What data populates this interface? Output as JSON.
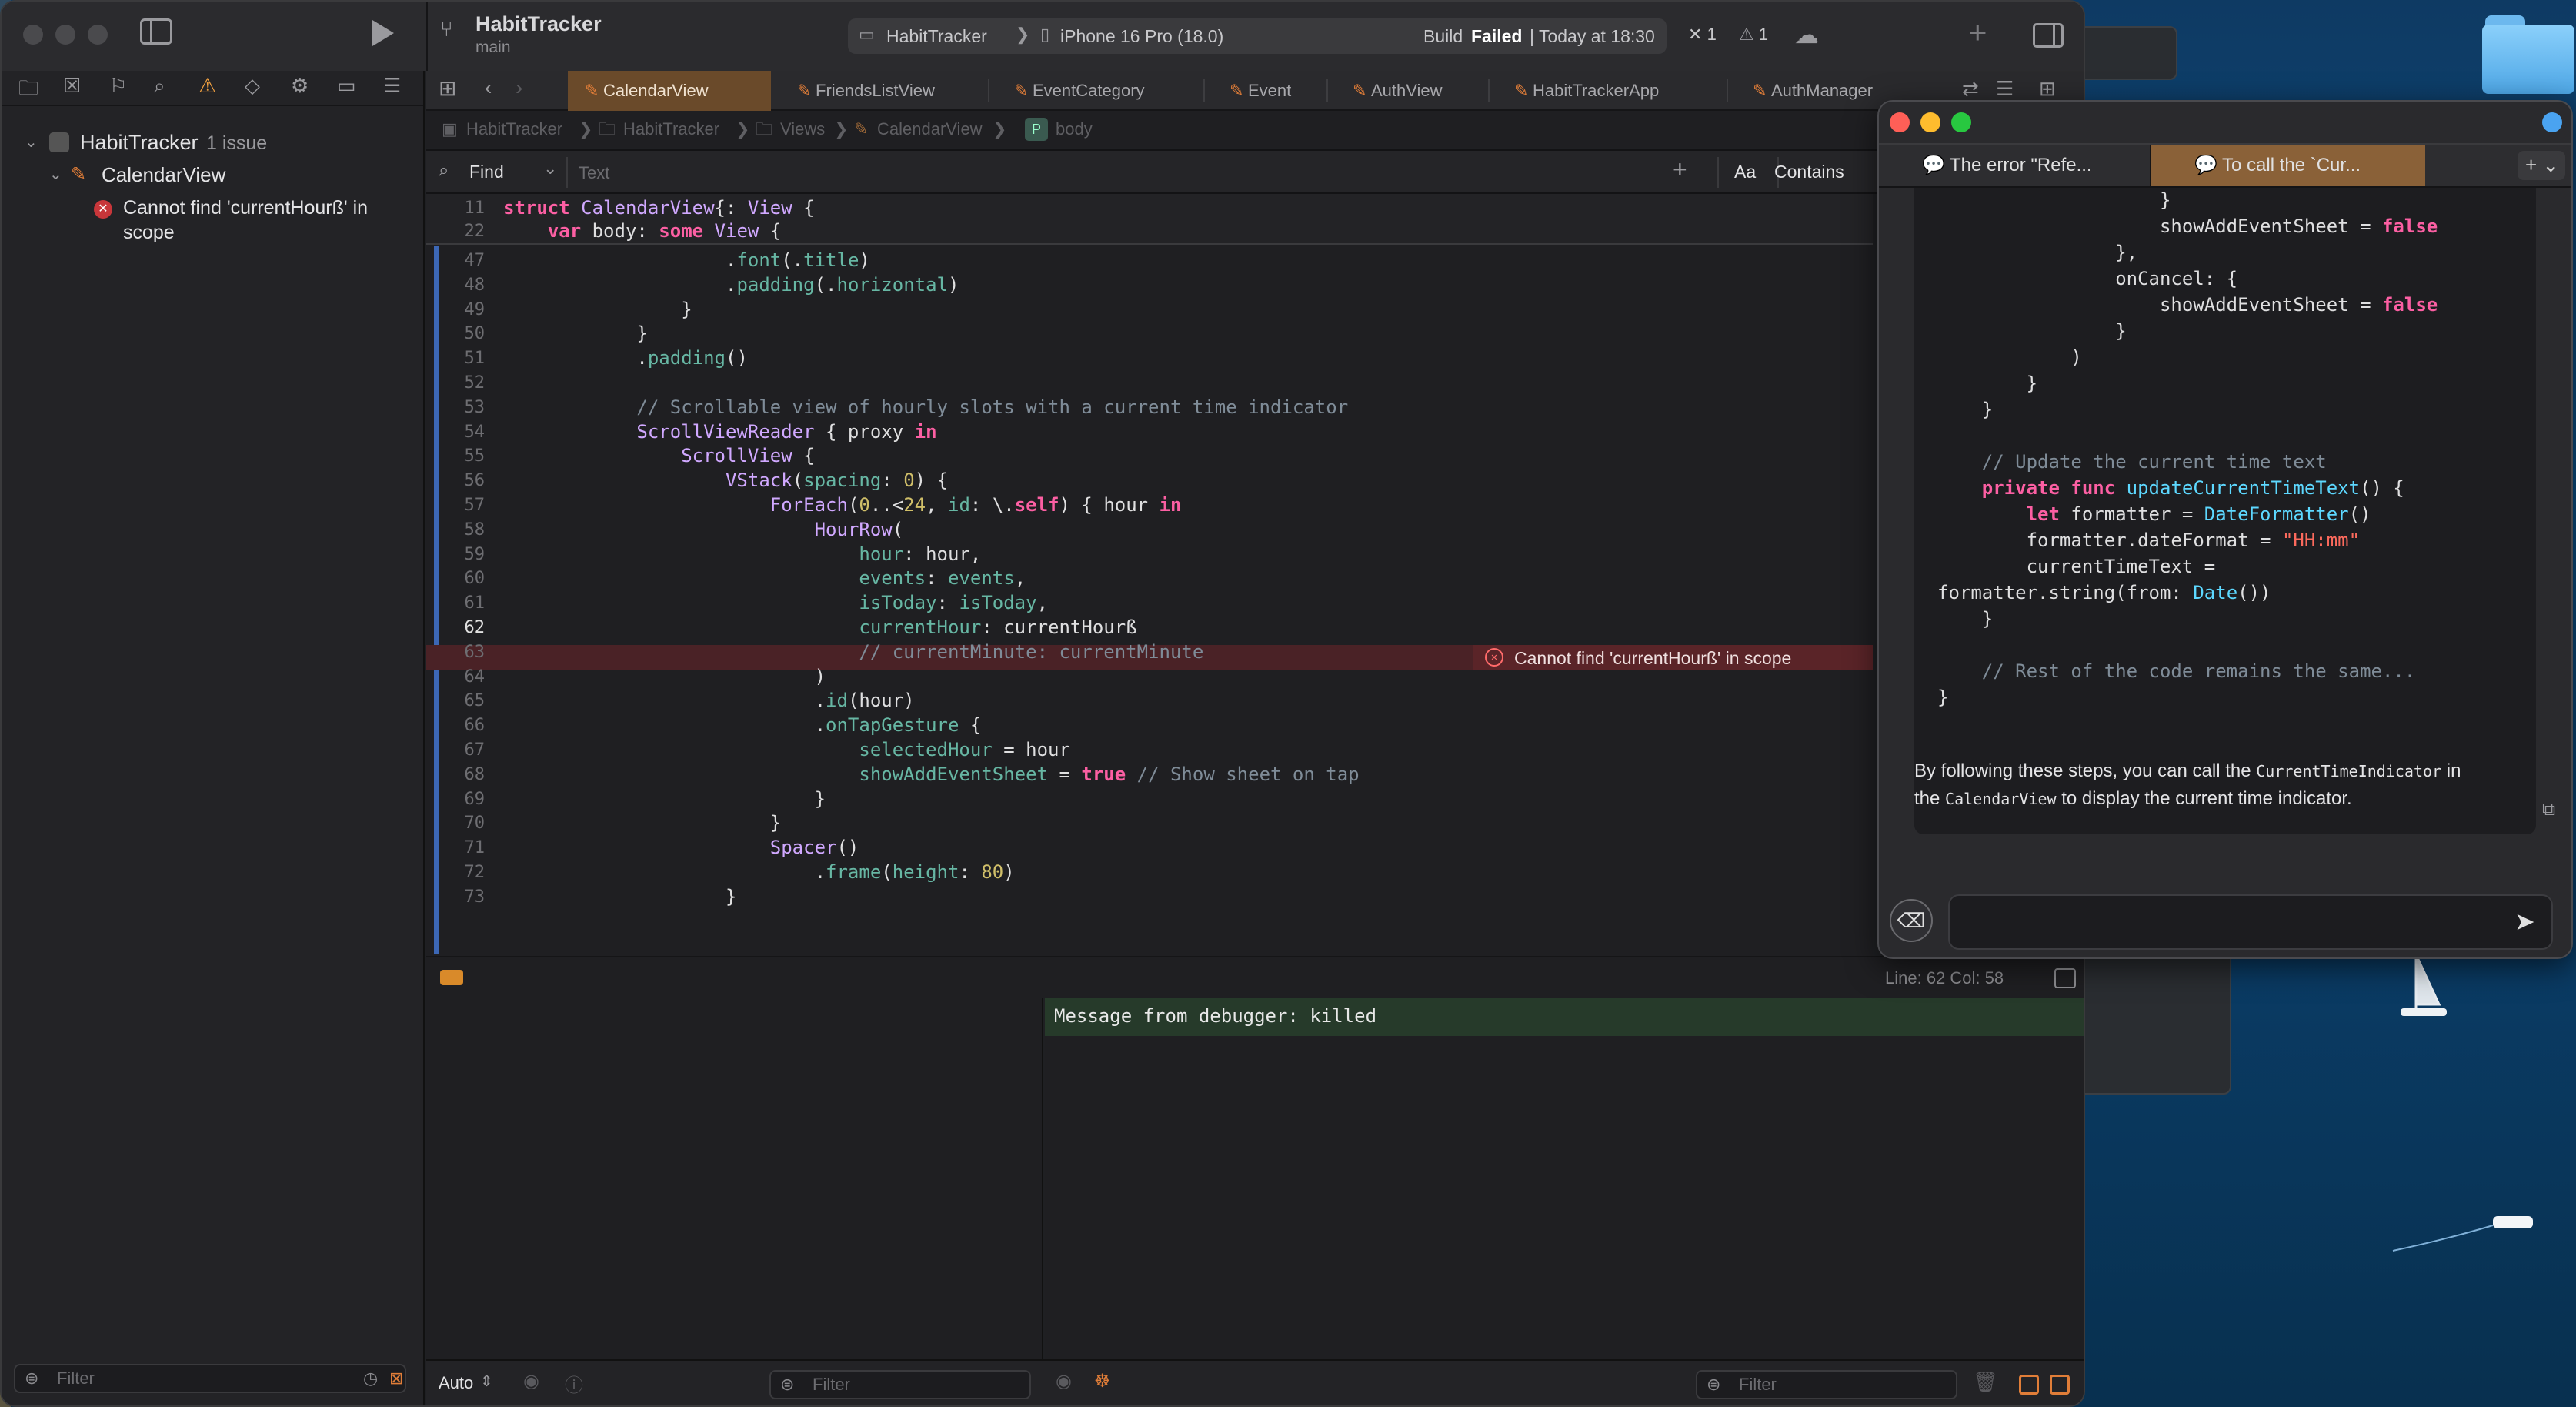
{
  "window": {
    "project_name": "HabitTracker",
    "branch": "main",
    "scheme": "HabitTracker",
    "destination": "iPhone 16 Pro (18.0)",
    "build_status_prefix": "Build",
    "build_status_result": "Failed",
    "build_status_time": "| Today at 18:30",
    "error_count": "1",
    "warning_count": "1"
  },
  "issue_navigator": {
    "project": "HabitTracker",
    "project_issue_count": "1 issue",
    "file": "CalendarView",
    "issue_line1": "Cannot find 'currentHourß' in",
    "issue_line2": "scope",
    "filter_placeholder": "Filter"
  },
  "tabs": [
    {
      "label": "CalendarView"
    },
    {
      "label": "FriendsListView"
    },
    {
      "label": "EventCategory"
    },
    {
      "label": "Event"
    },
    {
      "label": "AuthView"
    },
    {
      "label": "HabitTrackerApp"
    },
    {
      "label": "AuthManager"
    }
  ],
  "breadcrumb": [
    "HabitTracker",
    "HabitTracker",
    "Views",
    "CalendarView",
    "body"
  ],
  "find": {
    "mode": "Find",
    "placeholder": "Text",
    "case_label": "Aa",
    "match_mode": "Contains"
  },
  "sticky_header": [
    {
      "num": "11",
      "tokens": [
        [
          "kw",
          "struct "
        ],
        [
          "ty",
          "CalendarView"
        ],
        [
          "",
          "{: "
        ],
        [
          "ty",
          "View"
        ],
        [
          "",
          " {"
        ]
      ]
    },
    {
      "num": "22",
      "tokens": [
        [
          "",
          "    "
        ],
        [
          "kw",
          "var "
        ],
        [
          "",
          "body: "
        ],
        [
          "kw",
          "some "
        ],
        [
          "ty",
          "View"
        ],
        [
          "",
          " {"
        ]
      ]
    }
  ],
  "code_lines": [
    {
      "num": "47",
      "tokens": [
        [
          "",
          "                    ."
        ],
        [
          "fn",
          "font"
        ],
        [
          "",
          "(."
        ],
        [
          "fn",
          "title"
        ],
        [
          "",
          ")"
        ]
      ]
    },
    {
      "num": "48",
      "tokens": [
        [
          "",
          "                    ."
        ],
        [
          "fn",
          "padding"
        ],
        [
          "",
          "(."
        ],
        [
          "fn",
          "horizontal"
        ],
        [
          "",
          ")"
        ]
      ]
    },
    {
      "num": "49",
      "tokens": [
        [
          "",
          "                }"
        ]
      ]
    },
    {
      "num": "50",
      "tokens": [
        [
          "",
          "            }"
        ]
      ]
    },
    {
      "num": "51",
      "tokens": [
        [
          "",
          "            ."
        ],
        [
          "fn",
          "padding"
        ],
        [
          "",
          "()"
        ]
      ]
    },
    {
      "num": "52",
      "tokens": [
        [
          "",
          ""
        ]
      ]
    },
    {
      "num": "53",
      "tokens": [
        [
          "cm",
          "            // Scrollable view of hourly slots with a current time indicator"
        ]
      ]
    },
    {
      "num": "54",
      "tokens": [
        [
          "",
          "            "
        ],
        [
          "ty",
          "ScrollViewReader"
        ],
        [
          "",
          " { proxy "
        ],
        [
          "kw",
          "in"
        ]
      ]
    },
    {
      "num": "55",
      "tokens": [
        [
          "",
          "                "
        ],
        [
          "ty",
          "ScrollView"
        ],
        [
          "",
          " {"
        ]
      ]
    },
    {
      "num": "56",
      "tokens": [
        [
          "",
          "                    "
        ],
        [
          "ty",
          "VStack"
        ],
        [
          "",
          "("
        ],
        [
          "fn",
          "spacing"
        ],
        [
          "",
          ": "
        ],
        [
          "nm",
          "0"
        ],
        [
          "",
          ") {"
        ]
      ]
    },
    {
      "num": "57",
      "tokens": [
        [
          "",
          "                        "
        ],
        [
          "ty",
          "ForEach"
        ],
        [
          "",
          "("
        ],
        [
          "nm",
          "0"
        ],
        [
          "",
          "..<"
        ],
        [
          "nm",
          "24"
        ],
        [
          "",
          ", "
        ],
        [
          "fn",
          "id"
        ],
        [
          "",
          ": \\."
        ],
        [
          "kw",
          "self"
        ],
        [
          "",
          ") { hour "
        ],
        [
          "kw",
          "in"
        ]
      ]
    },
    {
      "num": "58",
      "tokens": [
        [
          "",
          "                            "
        ],
        [
          "ty",
          "HourRow"
        ],
        [
          "",
          "("
        ]
      ]
    },
    {
      "num": "59",
      "tokens": [
        [
          "",
          "                                "
        ],
        [
          "fn",
          "hour"
        ],
        [
          "",
          ": hour,"
        ]
      ]
    },
    {
      "num": "60",
      "tokens": [
        [
          "",
          "                                "
        ],
        [
          "fn",
          "events"
        ],
        [
          "",
          ": "
        ],
        [
          "fn",
          "events"
        ],
        [
          "",
          ","
        ]
      ]
    },
    {
      "num": "61",
      "tokens": [
        [
          "",
          "                                "
        ],
        [
          "fn",
          "isToday"
        ],
        [
          "",
          ": "
        ],
        [
          "fn",
          "isToday"
        ],
        [
          "",
          ","
        ]
      ]
    },
    {
      "num": "62",
      "tokens": [
        [
          "",
          "                                "
        ],
        [
          "fn",
          "currentHour"
        ],
        [
          "",
          ": currentHourß"
        ]
      ]
    },
    {
      "num": "63",
      "tokens": [
        [
          "cm",
          "                                // currentMinute: currentMinute"
        ]
      ]
    },
    {
      "num": "64",
      "tokens": [
        [
          "",
          "                            )"
        ]
      ]
    },
    {
      "num": "65",
      "tokens": [
        [
          "",
          "                            ."
        ],
        [
          "fn",
          "id"
        ],
        [
          "",
          "(hour)"
        ]
      ]
    },
    {
      "num": "66",
      "tokens": [
        [
          "",
          "                            ."
        ],
        [
          "fn",
          "onTapGesture"
        ],
        [
          "",
          " {"
        ]
      ]
    },
    {
      "num": "67",
      "tokens": [
        [
          "",
          "                                "
        ],
        [
          "fn",
          "selectedHour"
        ],
        [
          "",
          " = hour"
        ]
      ]
    },
    {
      "num": "68",
      "tokens": [
        [
          "",
          "                                "
        ],
        [
          "fn",
          "showAddEventSheet"
        ],
        [
          "",
          " = "
        ],
        [
          "kw",
          "true"
        ],
        [
          "cm",
          " // Show sheet on tap"
        ]
      ]
    },
    {
      "num": "69",
      "tokens": [
        [
          "",
          "                            }"
        ]
      ]
    },
    {
      "num": "70",
      "tokens": [
        [
          "",
          "                        }"
        ]
      ]
    },
    {
      "num": "71",
      "tokens": [
        [
          "",
          "                        "
        ],
        [
          "ty",
          "Spacer"
        ],
        [
          "",
          "()"
        ]
      ]
    },
    {
      "num": "72",
      "tokens": [
        [
          "",
          "                            ."
        ],
        [
          "fn",
          "frame"
        ],
        [
          "",
          "("
        ],
        [
          "fn",
          "height"
        ],
        [
          "",
          ": "
        ],
        [
          "nm",
          "80"
        ],
        [
          "",
          ")"
        ]
      ]
    },
    {
      "num": "73",
      "tokens": [
        [
          "",
          "                    }"
        ]
      ]
    }
  ],
  "inline_error": "Cannot find 'currentHourß' in scope",
  "status": {
    "line_col": "Line: 62  Col: 58"
  },
  "console": {
    "message": "Message from debugger: killed"
  },
  "debug_bar": {
    "scope": "Auto",
    "filter_placeholder": "Filter"
  },
  "chat": {
    "tab1": "The error \"Refe...",
    "tab2": "To call the `Cur...",
    "code_lines": [
      {
        "tokens": [
          [
            "",
            "                    }"
          ]
        ]
      },
      {
        "tokens": [
          [
            "",
            "                    showAddEventSheet = "
          ],
          [
            "kw",
            "false"
          ]
        ]
      },
      {
        "tokens": [
          [
            "",
            "                },"
          ]
        ]
      },
      {
        "tokens": [
          [
            "",
            "                onCancel: {"
          ]
        ]
      },
      {
        "tokens": [
          [
            "",
            "                    showAddEventSheet = "
          ],
          [
            "kw",
            "false"
          ]
        ]
      },
      {
        "tokens": [
          [
            "",
            "                }"
          ]
        ]
      },
      {
        "tokens": [
          [
            "",
            "            )"
          ]
        ]
      },
      {
        "tokens": [
          [
            "",
            "        }"
          ]
        ]
      },
      {
        "tokens": [
          [
            "",
            "    }"
          ]
        ]
      },
      {
        "tokens": [
          [
            "",
            ""
          ]
        ]
      },
      {
        "tokens": [
          [
            "cm",
            "    // Update the current time text"
          ]
        ]
      },
      {
        "tokens": [
          [
            "",
            "    "
          ],
          [
            "kw",
            "private func "
          ],
          [
            "ot",
            "updateCurrentTimeText"
          ],
          [
            "",
            "() {"
          ]
        ]
      },
      {
        "tokens": [
          [
            "",
            "        "
          ],
          [
            "kw",
            "let "
          ],
          [
            "",
            "formatter = "
          ],
          [
            "ot",
            "DateFormatter"
          ],
          [
            "",
            "()"
          ]
        ]
      },
      {
        "tokens": [
          [
            "",
            "        formatter.dateFormat = "
          ],
          [
            "st",
            "\"HH:mm\""
          ]
        ]
      },
      {
        "tokens": [
          [
            "",
            "        currentTimeText ="
          ]
        ]
      },
      {
        "tokens": [
          [
            "",
            "formatter.string(from: "
          ],
          [
            "ot",
            "Date"
          ],
          [
            "",
            "())"
          ]
        ]
      },
      {
        "tokens": [
          [
            "",
            "    }"
          ]
        ]
      },
      {
        "tokens": [
          [
            "",
            ""
          ]
        ]
      },
      {
        "tokens": [
          [
            "cm",
            "    // Rest of the code remains the same..."
          ]
        ]
      },
      {
        "tokens": [
          [
            "",
            "}"
          ]
        ]
      }
    ],
    "answer_prefix": "By following these steps, you can call the ",
    "answer_code1": "CurrentTimeIndicator",
    "answer_mid": " in",
    "answer_line2_prefix": "the ",
    "answer_code2": "CalendarView",
    "answer_suffix": " to display the current time indicator.",
    "input_value": ""
  }
}
